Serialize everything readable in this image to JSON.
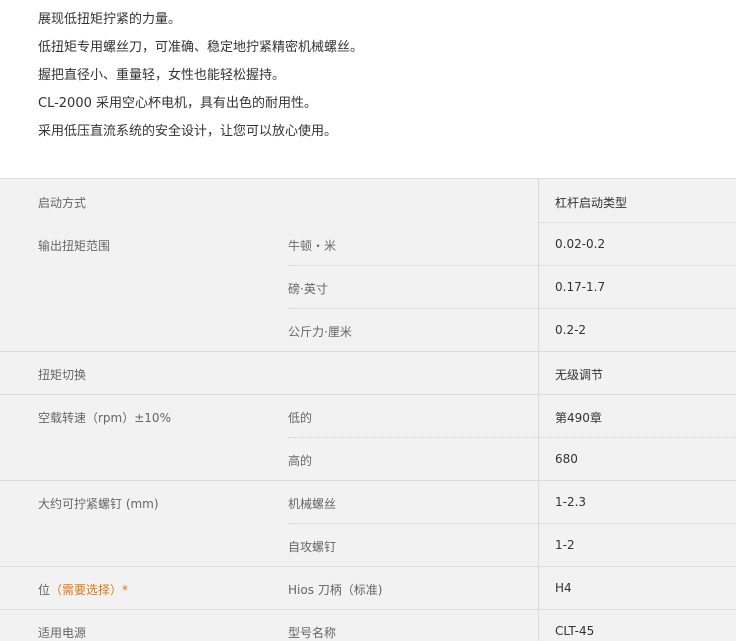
{
  "intro": [
    "展现低扭矩拧紧的力量。",
    "低扭矩专用螺丝刀，可准确、稳定地拧紧精密机械螺丝。",
    "握把直径小、重量轻，女性也能轻松握持。",
    "CL-2000 采用空心杯电机，具有出色的耐用性。",
    "采用低压直流系统的安全设计，让您可以放心使用。"
  ],
  "spec": {
    "start_method": {
      "label": "启动方式",
      "value": "杠杆启动类型"
    },
    "torque_range": {
      "label": "输出扭矩范围",
      "rows": [
        {
          "unit": "牛顿・米",
          "value": "0.02-0.2"
        },
        {
          "unit": "磅·英寸",
          "value": "0.17-1.7"
        },
        {
          "unit": "公斤力·厘米",
          "value": "0.2-2"
        }
      ]
    },
    "torque_switch": {
      "label": "扭矩切换",
      "value": "无级调节"
    },
    "no_load_speed": {
      "label": "空载转速（rpm）±10%",
      "rows": [
        {
          "sub": "低的",
          "value": "第490章"
        },
        {
          "sub": "高的",
          "value": "680"
        }
      ]
    },
    "screw_size": {
      "label": "大约可拧紧螺钉 (mm)",
      "rows": [
        {
          "sub": "机械螺丝",
          "value": "1-2.3"
        },
        {
          "sub": "自攻螺钉",
          "value": "1-2"
        }
      ]
    },
    "bit": {
      "label_prefix": "位",
      "required_link": "（需要选择）",
      "required_star": "*",
      "sub": "Hios 刀柄（标准)",
      "value": "H4"
    },
    "power": {
      "label": "适用电源",
      "sub": "型号名称",
      "value": "CLT-45"
    }
  }
}
